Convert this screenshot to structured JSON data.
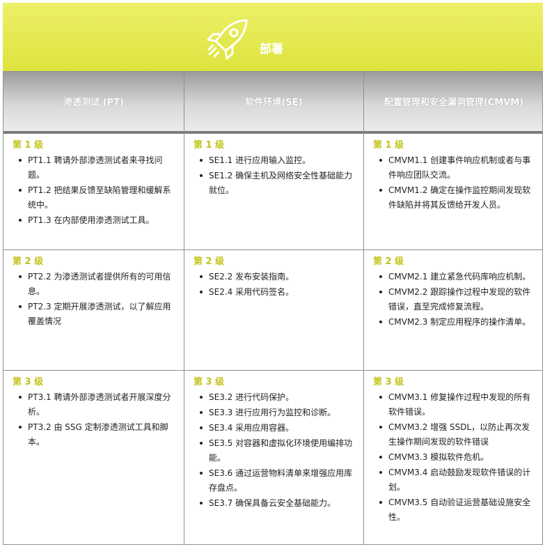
{
  "banner": {
    "title": "部署",
    "icon": "rocket-icon"
  },
  "columns": [
    {
      "header": "渗透测试 (PT)"
    },
    {
      "header": "软件环境(SE)"
    },
    {
      "header": "配置管理和安全漏洞管理(CMVM)"
    }
  ],
  "rows": [
    {
      "level": "第 1 级",
      "cells": [
        [
          "PT1.1 聘请外部渗透测试者来寻找问题。",
          "PT1.2 把结果反馈至缺陷管理和缓解系统中。",
          "PT1.3 在内部使用渗透测试工具。"
        ],
        [
          "SE1.1 进行应用输入监控。",
          "SE1.2 确保主机及网络安全性基础能力就位。"
        ],
        [
          "CMVM1.1 创建事件响应机制或者与事件响应团队交流。",
          "CMVM1.2 确定在操作监控期间发现软件缺陷并将其反馈给开发人员。"
        ]
      ]
    },
    {
      "level": "第 2 级",
      "cells": [
        [
          "PT2.2 为渗透测试者提供所有的可用信息。",
          "PT2.3 定期开展渗透测试，以了解应用覆盖情况"
        ],
        [
          "SE2.2 发布安装指南。",
          "SE2.4 采用代码签名。"
        ],
        [
          "CMVM2.1 建立紧急代码库响应机制。",
          "CMVM2.2 跟踪操作过程中发现的软件错误，直至完成修复流程。",
          "CMVM2.3 制定应用程序的操作清单。"
        ]
      ]
    },
    {
      "level": "第 3 级",
      "cells": [
        [
          "PT3.1 聘请外部渗透测试者开展深度分析。",
          "PT3.2 由 SSG 定制渗透测试工具和脚本。"
        ],
        [
          "SE3.2 进行代码保护。",
          "SE3.3 进行应用行为监控和诊断。",
          "SE3.4 采用应用容器。",
          "SE3.5 对容器和虚拟化环境使用编排功能。",
          "SE3.6 通过运营物料清单来增强应用库存盘点。",
          "SE3.7 确保具备云安全基础能力。"
        ],
        [
          "CMVM3.1 修复操作过程中发现的所有软件错误。",
          "CMVM3.2 增强 SSDL，以防止再次发生操作期间发现的软件错误",
          "CMVM3.3 模拟软件危机。",
          "CMVM3.4 启动鼓励发现软件错误的计划。",
          "CMVM3.5 自动验证运营基础设施安全性。"
        ]
      ]
    }
  ]
}
